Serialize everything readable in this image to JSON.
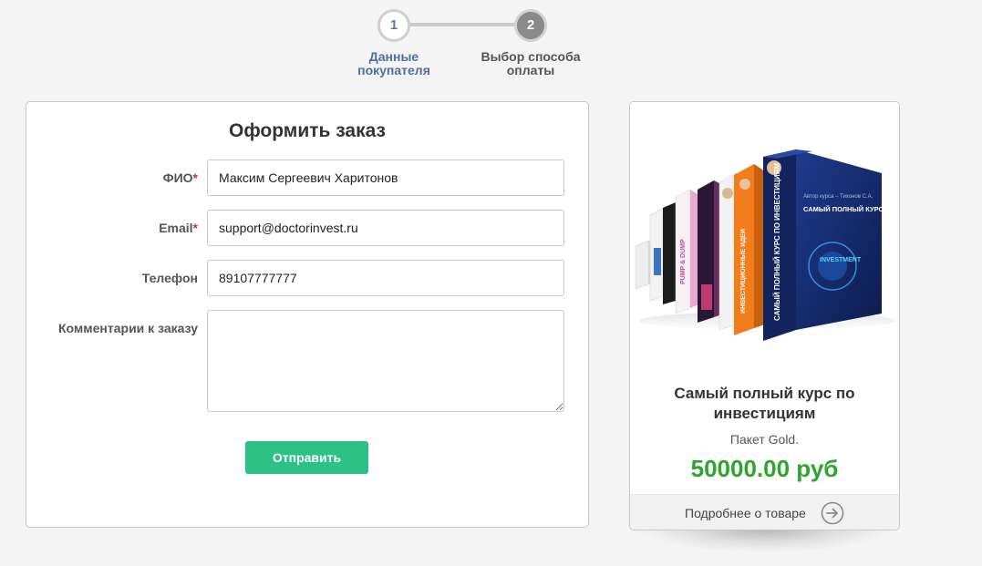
{
  "steps": [
    {
      "number": "1",
      "label_line1": "Данные",
      "label_line2": "покупателя"
    },
    {
      "number": "2",
      "label_line1": "Выбор способа",
      "label_line2": "оплаты"
    }
  ],
  "form": {
    "title": "Оформить заказ",
    "fields": {
      "fio": {
        "label": "ФИО",
        "required_mark": "*",
        "value": "Максим Сергеевич Харитонов"
      },
      "email": {
        "label": "Email",
        "required_mark": "*",
        "value": "support@doctorinvest.ru"
      },
      "phone": {
        "label": "Телефон",
        "value": "89107777777"
      },
      "comment": {
        "label": "Комментарии к заказу",
        "value": ""
      }
    },
    "submit_label": "Отправить"
  },
  "product": {
    "title": "Самый полный курс по инвестициям",
    "package": "Пакет Gold.",
    "price": "50000.00 руб",
    "more_label": "Подробнее о товаре",
    "image_box_text": "САМЫЙ ПОЛНЫЙ КУРС ПО ИНВЕСТИЦИЯМ",
    "image_box_side_text": "САМЫЙ ПОЛНЫЙ КУРС ПО ИНВЕСТИЦИЯМ",
    "image_box_author": "Автор курса – Тихонов С.А.",
    "image_box_brand": "INVESTMENT",
    "image_orange_side": "ИНВЕСТИЦИОННЫЕ ИДЕИ",
    "image_pink_side": "PUMP & DUMP"
  },
  "colors": {
    "accent_green": "#2cc185",
    "price_green": "#2ea52e",
    "step_active_text": "#4b6fa3",
    "required": "#c0392b"
  },
  "icons": {
    "more_arrow": "arrow-right-circle-icon"
  }
}
